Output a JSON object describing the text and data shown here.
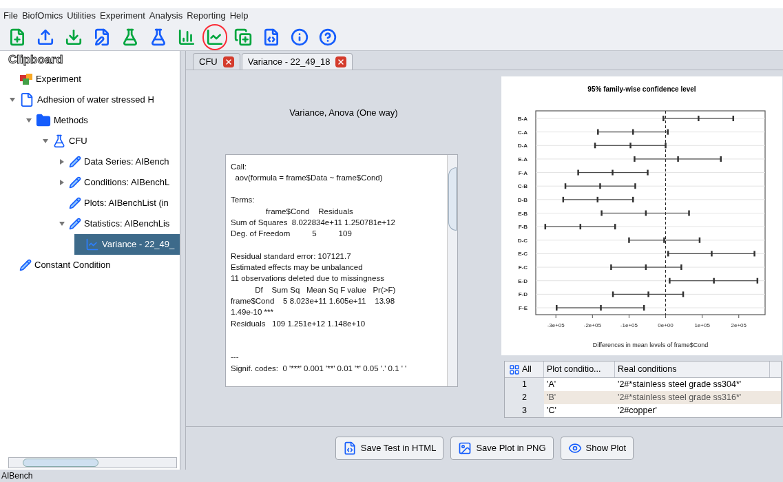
{
  "menu": [
    "File",
    "BiofOmics",
    "Utilities",
    "Experiment",
    "Analysis",
    "Reporting",
    "Help"
  ],
  "toolbar": [
    {
      "kind": "new-file",
      "circled": false
    },
    {
      "kind": "upload",
      "circled": false
    },
    {
      "kind": "download",
      "circled": false
    },
    {
      "kind": "edit-file",
      "circled": false
    },
    {
      "kind": "flask-add",
      "circled": false
    },
    {
      "kind": "flask-edit",
      "circled": false
    },
    {
      "kind": "bar-chart",
      "circled": false
    },
    {
      "kind": "line-chart-add",
      "circled": true
    },
    {
      "kind": "copy-add",
      "circled": false
    },
    {
      "kind": "code-file",
      "circled": false
    },
    {
      "kind": "info",
      "circled": false
    },
    {
      "kind": "help",
      "circled": false
    }
  ],
  "clipboard": {
    "title": "Clipboard",
    "tree": [
      {
        "label": "Experiment",
        "kind": "experiment",
        "selected": false
      },
      {
        "label": "Adhesion of water stressed H",
        "kind": "document",
        "expanded": true,
        "selected": false,
        "children": [
          {
            "label": "Methods",
            "kind": "folder",
            "expanded": true,
            "selected": false,
            "children": [
              {
                "label": "CFU",
                "kind": "flask",
                "expanded": true,
                "selected": false,
                "children": [
                  {
                    "label": "Data Series: AIBench",
                    "kind": "list",
                    "expanded": false,
                    "selected": false
                  },
                  {
                    "label": "Conditions: AIBenchL",
                    "kind": "list",
                    "expanded": false,
                    "selected": false
                  },
                  {
                    "label": "Plots: AIBenchList (in",
                    "kind": "list",
                    "selected": false
                  },
                  {
                    "label": "Statistics: AIBenchLis",
                    "kind": "list",
                    "expanded": true,
                    "selected": false,
                    "children": [
                      {
                        "label": "Variance - 22_49_",
                        "kind": "chart",
                        "selected": true
                      }
                    ]
                  }
                ]
              }
            ]
          }
        ]
      },
      {
        "label": "Constant Condition",
        "kind": "list",
        "selected": false
      }
    ]
  },
  "tabs": [
    {
      "label": "CFU",
      "selected": false
    },
    {
      "label": "Variance - 22_49_18",
      "selected": true
    }
  ],
  "result": {
    "heading": "Variance, Anova (One way)",
    "blocks": [
      [
        "Call:",
        "  aov(formula = frame$Data ~ frame$Cond)"
      ],
      [
        "Terms:",
        "                frame$Cond    Residuals",
        "Sum of Squares  8.022834e+11 1.250781e+12",
        "Deg. of Freedom          5          109"
      ],
      [
        "Residual standard error: 107121.7",
        "Estimated effects may be unbalanced",
        "11 observations deleted due to missingness",
        "           Df    Sum Sq   Mean Sq F value   Pr(>F)",
        "frame$Cond    5 8.023e+11 1.605e+11    13.98",
        "1.49e-10 ***",
        "Residuals   109 1.251e+12 1.148e+10"
      ],
      [
        "---",
        "Signif. codes:  0 '***' 0.001 '**' 0.01 '*' 0.05 '.' 0.1 ' '"
      ]
    ]
  },
  "plot": {
    "chart_data": {
      "type": "scatter",
      "orientation": "horizontal",
      "title": "95% family-wise confidence level",
      "xlabel": "Differences in mean levels of frame$Cond",
      "categories": [
        "B-A",
        "C-A",
        "D-A",
        "E-A",
        "F-A",
        "C-B",
        "D-B",
        "E-B",
        "F-B",
        "D-C",
        "E-C",
        "F-C",
        "E-D",
        "F-D",
        "F-E"
      ],
      "series": [
        {
          "color": "#333333",
          "values": [
            -6000,
            -185000,
            -193000,
            -85000,
            -239000,
            -274000,
            -280000,
            -175000,
            -329000,
            -100000,
            7000,
            -149000,
            11000,
            -144000,
            -298000
          ]
        },
        {
          "color": "#333333",
          "values": [
            90000,
            -89000,
            -96000,
            34000,
            -145000,
            -179000,
            -186000,
            -54000,
            -233000,
            -4000,
            126000,
            -54000,
            132000,
            -47000,
            -177000
          ]
        },
        {
          "color": "#333333",
          "values": [
            185000,
            6000,
            0,
            151000,
            -49000,
            -83000,
            -89000,
            64000,
            -138000,
            93000,
            243000,
            43000,
            251000,
            48000,
            -59000
          ]
        }
      ],
      "xlim": [
        -355000,
        272000
      ],
      "grid": true,
      "ref_lines": [
        {
          "axis": "x",
          "value": 0
        }
      ],
      "xticks": [
        {
          "value": -300000,
          "label": "-3e+05"
        },
        {
          "value": -200000,
          "label": "-2e+05"
        },
        {
          "value": -100000,
          "label": "-1e+05"
        },
        {
          "value": 0,
          "label": "0e+00"
        },
        {
          "value": 100000,
          "label": "1e+05"
        },
        {
          "value": 200000,
          "label": "2e+05"
        }
      ]
    }
  },
  "conditions": {
    "all_label": "All",
    "columns": [
      "Plot conditio...",
      "Real conditions"
    ],
    "rows": [
      {
        "index": "1",
        "plot": "'A'",
        "real": "'2#*stainless steel grade ss304*'",
        "selected": false
      },
      {
        "index": "2",
        "plot": "'B'",
        "real": "'2#*stainless steel grade ss316*'",
        "selected": true
      },
      {
        "index": "3",
        "plot": "'C'",
        "real": "'2#copper'",
        "selected": false
      }
    ]
  },
  "buttons": [
    {
      "label": "Save Test in HTML",
      "kind": "html"
    },
    {
      "label": "Save Plot in PNG",
      "kind": "image"
    },
    {
      "label": "Show Plot",
      "kind": "eye"
    }
  ],
  "status": "AIBench"
}
